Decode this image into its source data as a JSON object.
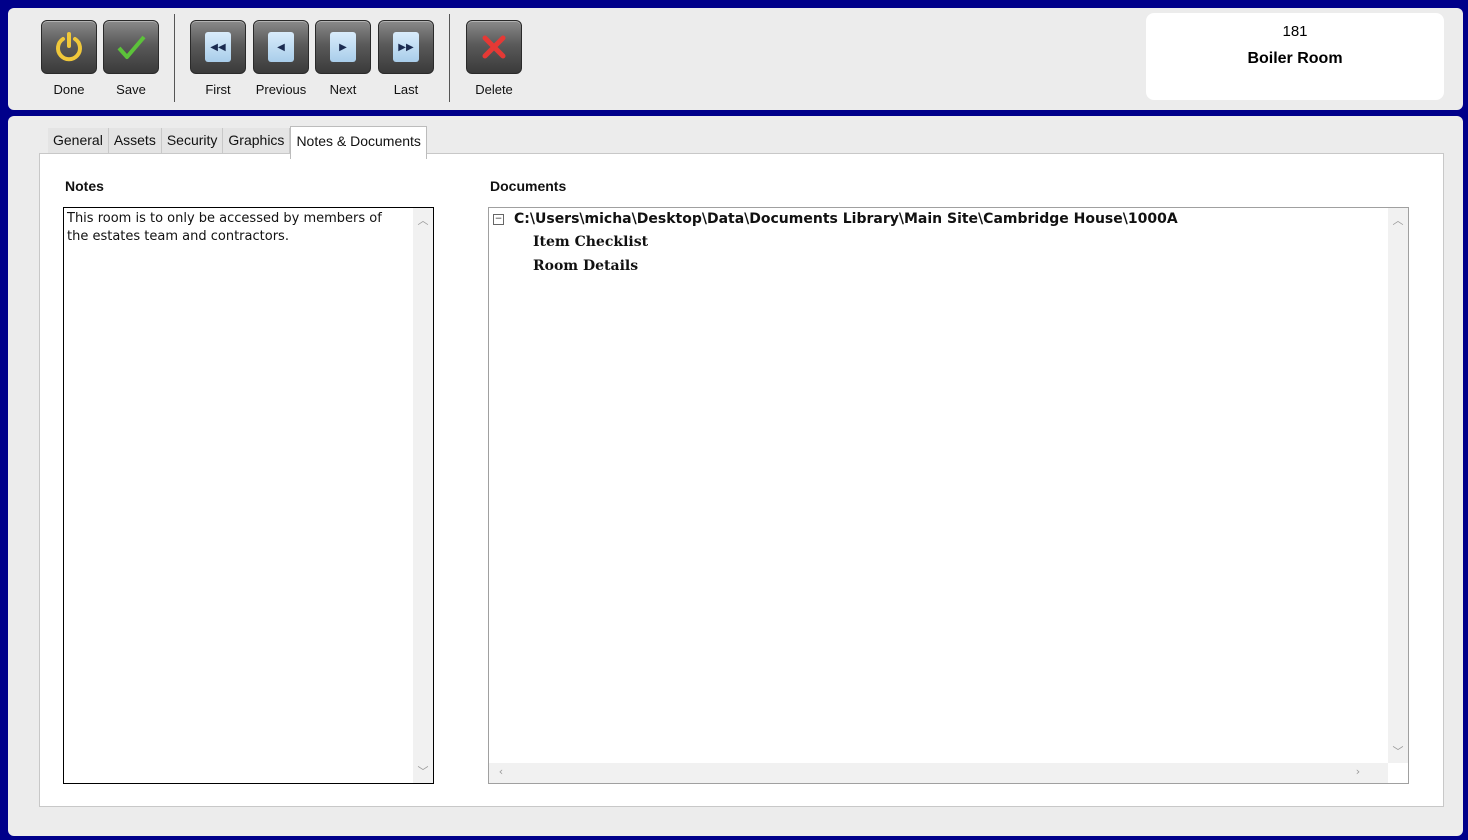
{
  "toolbar": {
    "done_label": "Done",
    "save_label": "Save",
    "first_label": "First",
    "previous_label": "Previous",
    "next_label": "Next",
    "last_label": "Last",
    "delete_label": "Delete"
  },
  "record": {
    "number": "181",
    "name": "Boiler Room"
  },
  "tabs": [
    {
      "label": "General"
    },
    {
      "label": "Assets"
    },
    {
      "label": "Security"
    },
    {
      "label": "Graphics"
    },
    {
      "label": "Notes & Documents",
      "active": true
    }
  ],
  "notes": {
    "label": "Notes",
    "text": "This room is to only be accessed by members of the estates team and contractors."
  },
  "documents": {
    "label": "Documents",
    "root": "C:\\Users\\micha\\Desktop\\Data\\Documents Library\\Main Site\\Cambridge House\\1000A",
    "items": [
      "Item Checklist",
      "Room Details"
    ]
  },
  "colors": {
    "frame": "#00008a",
    "panel": "#ececec",
    "done_icon": "#e8c44a",
    "save_icon": "#4caf2a",
    "delete_icon": "#d32f2f"
  }
}
